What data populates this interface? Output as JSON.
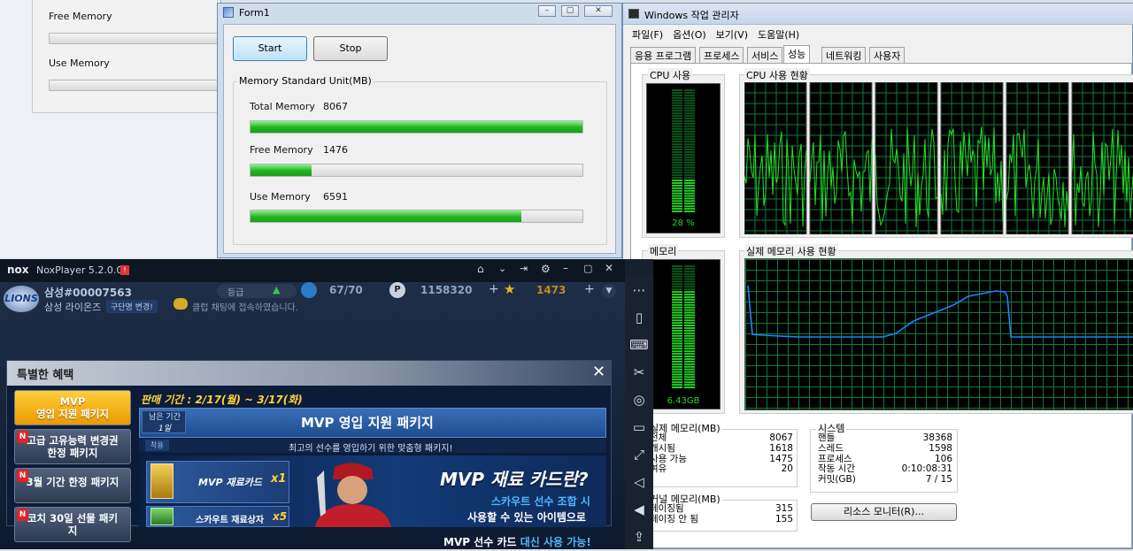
{
  "bg_window": {
    "free_memory": "Free Memory",
    "use_memory": "Use Memory"
  },
  "form1": {
    "title": "Form1",
    "start": "Start",
    "stop": "Stop",
    "group": "Memory Standard Unit(MB)",
    "total_label": "Total Memory",
    "total_value": "8067",
    "total_fraction": 1.0,
    "free_label": "Free Memory",
    "free_value": "1476",
    "free_fraction": 0.183,
    "use_label": "Use Memory",
    "use_value": "6591",
    "use_fraction": 0.817
  },
  "taskmgr": {
    "title": "Windows 작업 관리자",
    "menu": [
      "파일(F)",
      "옵션(O)",
      "보기(V)",
      "도움말(H)"
    ],
    "tabs": [
      "응용 프로그램",
      "프로세스",
      "서비스",
      "성능",
      "네트워킹",
      "사용자"
    ],
    "cpu_usage_title": "CPU 사용",
    "cpu_usage_value": "28 %",
    "cpu_usage_fraction": 0.28,
    "cpu_history_title": "CPU 사용 현황",
    "mem_title": "메모리",
    "mem_value": "6.43GB",
    "mem_fraction": 0.8,
    "mem_history_title": "실제 메모리 사용 현황",
    "physical": {
      "title": "실제 메모리(MB)",
      "rows": [
        [
          "전체",
          "8067"
        ],
        [
          "캐시됨",
          "1618"
        ],
        [
          "사용 가능",
          "1475"
        ],
        [
          "여유",
          "20"
        ]
      ]
    },
    "system": {
      "title": "시스템",
      "rows": [
        [
          "핸들",
          "38368"
        ],
        [
          "스레드",
          "1598"
        ],
        [
          "프로세스",
          "106"
        ],
        [
          "작동 시간",
          "0:10:08:31"
        ],
        [
          "커밋(GB)",
          "7 / 15"
        ]
      ]
    },
    "kernel": {
      "title": "커널 메모리(MB)",
      "rows": [
        [
          "페이징됨",
          "315"
        ],
        [
          "페이징 안 됨",
          "155"
        ]
      ]
    },
    "resource_monitor": "리소스 모니터(R)..."
  },
  "nox": {
    "app_title": "NoxPlayer 5.2.0.0",
    "logo": "nox",
    "player_id": "삼성#00007563",
    "team": "삼성 라이온즈",
    "team_change": "구단명 변경!",
    "chat_notice": "클럽 채팅에 접속하였습니다.",
    "grade": "등급",
    "stamina": "67/70",
    "points": "1158320",
    "stars": "1473",
    "dialog_title": "특별한 혜택",
    "left_menu": [
      {
        "label": "MVP\n영입 지원 패키지",
        "badge": ""
      },
      {
        "label": "고급 고유능력 변경권\n한정 패키지",
        "badge": "N"
      },
      {
        "label": "3월 기간 한정 패키지",
        "badge": "N"
      },
      {
        "label": "코치 30일 선물 패키\n지",
        "badge": "N"
      }
    ],
    "sale_period": "판매 기간 : 2/17(월) ~ 3/17(화)",
    "remaining_label": "남은 기간",
    "remaining_value": "1일",
    "package_title": "MVP 영입 지원 패키지",
    "package_sub": "최고의 선수를 영입하기 위한 맞춤형 패키지!",
    "badge_label": "착용",
    "item1": "MVP 재료카드",
    "item1_qty": "x1",
    "item2": "스카우트 재료상자",
    "item2_qty": "x5",
    "promo_title": "MVP 재료 카드란?",
    "promo_line1": "스카우트 선수 조합 시",
    "promo_line2": "사용할 수 있는 아이템으로",
    "promo_line3_a": "MVP 선수 카드 ",
    "promo_line3_b": "대신 사용 가능!",
    "close": "✕"
  }
}
